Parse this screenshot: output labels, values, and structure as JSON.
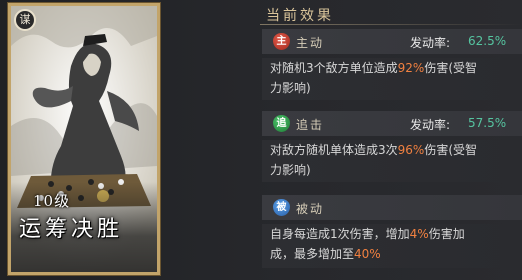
{
  "card": {
    "corner_label": "谋",
    "level": "10级",
    "name": "运筹决胜"
  },
  "panel": {
    "title": "当前效果"
  },
  "effects": [
    {
      "badge": "主",
      "badge_color": "#c0392b",
      "label": "主动",
      "rate_label": "发动率:",
      "rate_value": "62.5%",
      "desc_parts": [
        "对随机3个敌方单位造成",
        "92%",
        "伤害(受智",
        "力影响)"
      ]
    },
    {
      "badge": "追",
      "badge_color": "#2e8b4a",
      "label": "追击",
      "rate_label": "发动率:",
      "rate_value": "57.5%",
      "desc_parts": [
        "对敌方随机单体造成3次",
        "96%",
        "伤害(受智",
        "力影响)"
      ]
    },
    {
      "badge": "被",
      "badge_color": "#3a78c8",
      "label": "被动",
      "desc_parts": [
        "自身每造成1次伤害，增加",
        "4%",
        "伤害加",
        "成，最多增加至",
        "40%"
      ]
    }
  ],
  "colors": {
    "highlight": "#f08040",
    "rate": "#56c4a0",
    "card_border": "#c2a46a"
  }
}
